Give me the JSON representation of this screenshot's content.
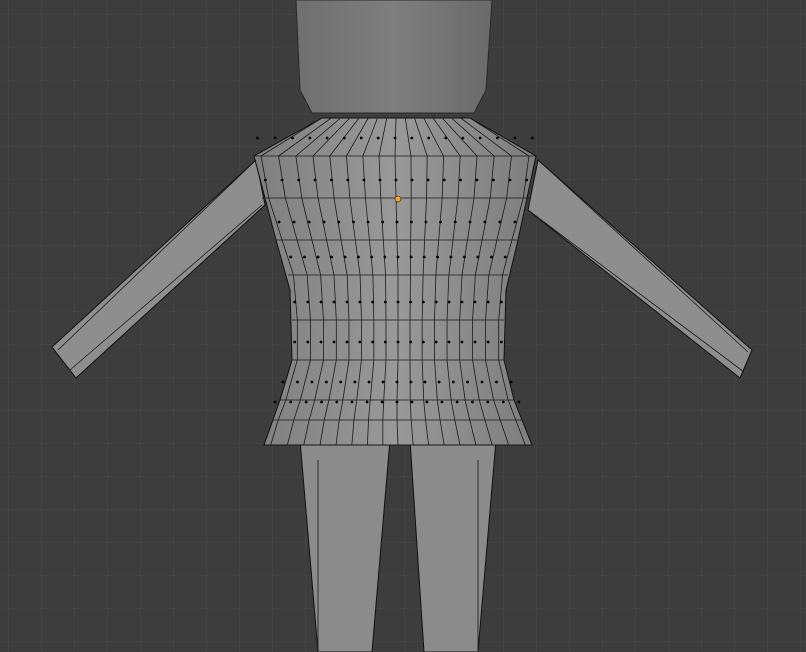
{
  "viewport": {
    "background": "#3d3d3d",
    "grid_minor": "#464646",
    "grid_major": "#505050",
    "mesh_fill": "#8a8a8a",
    "mesh_fill_light": "#9a9a9a",
    "edge": "#111111",
    "vertex": "#000000",
    "origin": "#f5a623"
  }
}
